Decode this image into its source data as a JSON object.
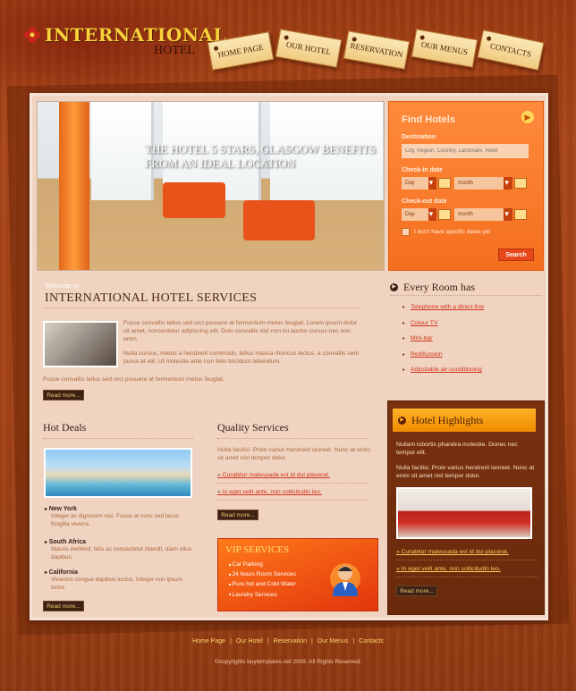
{
  "logo": {
    "title": "INTERNATIONAL",
    "subtitle": "HOTEL"
  },
  "nav": [
    "HOME PAGE",
    "OUR HOTEL",
    "RESERVATION",
    "OUR MENUS",
    "CONTACTS"
  ],
  "hero": {
    "caption_line1": "THE HOTEL 5 STARS, GLASGOW BENEFITS",
    "caption_line2": "FROM AN IDEAL LOCATION"
  },
  "find_hotels": {
    "title": "Find Hotels",
    "destination_label": "Destination",
    "destination_placeholder": "City, Region, Country, Landmark, Hotel",
    "checkin_label": "Check-in date",
    "checkout_label": "Check-out date",
    "day": "Day",
    "month": "month",
    "no_dates": "I don't have specific dates yet",
    "search": "Search"
  },
  "welcome": {
    "small": "Welcome to",
    "title": "INTERNATIONAL HOTEL SERVICES",
    "p1": "Fusce convallis tellus sed orci posuere at fermentum metus feugiat. Lorem ipsum dolor sit amet, consectetur adipiscing elit. Duis convallis nisi non mi auctor cursus nec non enim.",
    "p2": "Nulla cursus, metus a hendrerit commodo, tellus massa rhoncus lectus, a convallis sem purus at elit. Ut molestie ante non felis tincidunt bibendum.",
    "p3": "Fusce convallis tellus sed orci posuere at fermentum metus feugiat.",
    "more": "Read more..."
  },
  "every_room": {
    "title": "Every Room has",
    "items": [
      "Telephone with a direct line",
      "Colour TV",
      "Mini-bar",
      "Redifussion",
      "Adjustable air-conditioning"
    ]
  },
  "hot_deals": {
    "title": "Hot Deals",
    "cities": [
      {
        "name": "New York",
        "text": "Integer ac dignissim nisi. Fusce at nunc sed lacus fringilla viverra."
      },
      {
        "name": "South Africa",
        "text": "Mauris eleifend, felis ac consectetur blandit, diam ellus dapibus."
      },
      {
        "name": "California",
        "text": "Vivamus congue dapibus luctus. Integer non ipsum tortor."
      }
    ],
    "more": "Read more..."
  },
  "quality": {
    "title": "Quality Services",
    "text": "Nulla facilisi. Proin varius hendrerit laoreet. Nunc at enim sit amet nisl tempor dolor.",
    "links": [
      "Curabitur malesuada est id dui placerat.",
      "In eget velit ante, non sollicitudin leo."
    ],
    "more": "Read more..."
  },
  "vip": {
    "title": "VIP SERVICES",
    "items": [
      "Car Parking",
      "24 hours Room Services",
      "Pure hot and Cold Water",
      "Laundry Services"
    ]
  },
  "highlights": {
    "title": "Hotel Highlights",
    "p1": "Nullam lobortis pharetra molestie. Donec nec tempor elit.",
    "p2": "Nulla facilisi. Proin varius hendrerit laoreet. Nunc at enim sit amet nisl tempor dolor.",
    "links": [
      "Curabitur malesuada est id dui placerat.",
      "In eget velit ante, non sollicitudin leo."
    ],
    "more": "Read more..."
  },
  "footer": {
    "links": [
      "Home Page",
      "Our Hotel",
      "Reservation",
      "Our Menus",
      "Contacts"
    ],
    "copyright": "©copyrights buytemplates.net 2009. All Rights Reserved."
  }
}
